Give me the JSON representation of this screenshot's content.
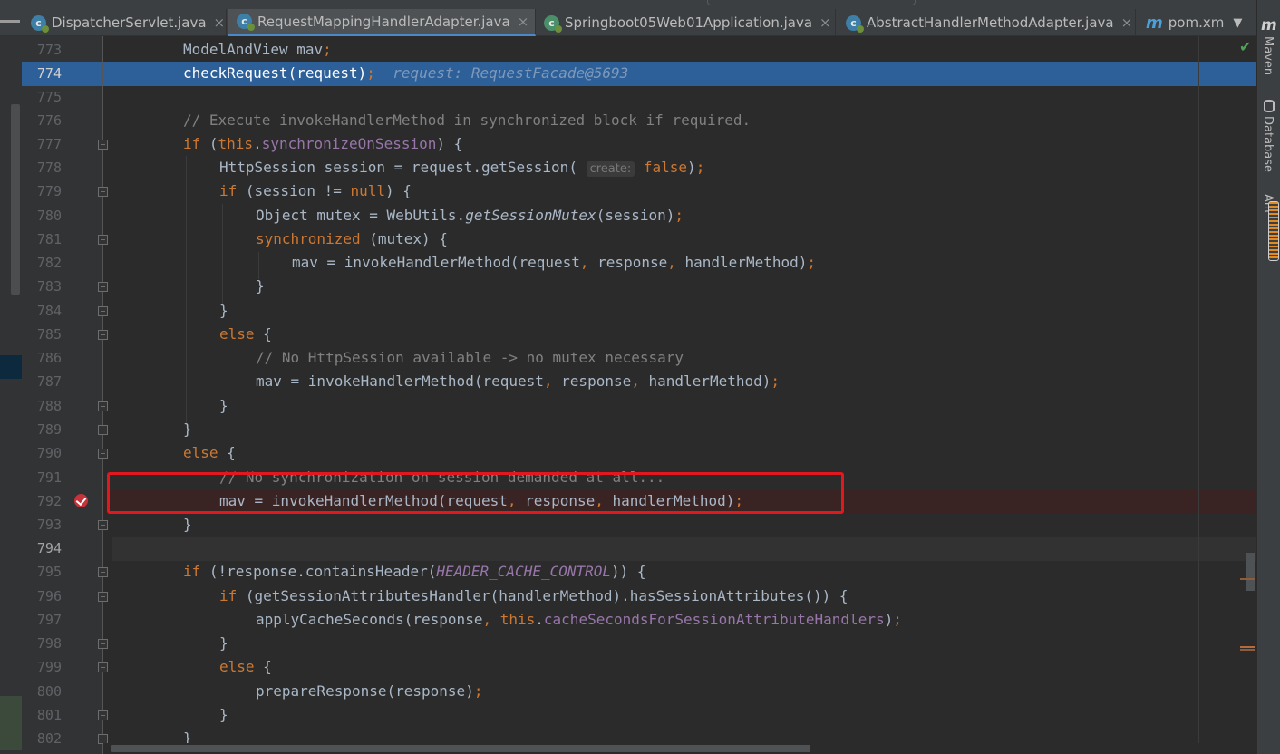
{
  "tabs": [
    {
      "label": "DispatcherServlet.java",
      "icon": "java-class-icon"
    },
    {
      "label": "RequestMappingHandlerAdapter.java",
      "icon": "java-class-icon",
      "active": true
    },
    {
      "label": "Springboot05Web01Application.java",
      "icon": "spring-boot-class-icon"
    },
    {
      "label": "AbstractHandlerMethodAdapter.java",
      "icon": "java-class-icon"
    },
    {
      "label": "pom.xm",
      "icon": "maven-icon"
    }
  ],
  "right_tool_windows": {
    "maven_icon": "m",
    "maven_label": "Maven",
    "database_label": "Database",
    "ant_label": "Ant"
  },
  "editor": {
    "current_line": "794",
    "highlighted_line": "774",
    "breakpoint_line": "792",
    "debug_value": "request: RequestFacade@5693",
    "param_hint": "create:",
    "lines": [
      {
        "n": "773",
        "t": "ModelAndView mav;"
      },
      {
        "n": "774",
        "t": "checkRequest(request);"
      },
      {
        "n": "775",
        "t": ""
      },
      {
        "n": "776",
        "t": "// Execute invokeHandlerMethod in synchronized block if required."
      },
      {
        "n": "777",
        "t": "if (this.synchronizeOnSession) {"
      },
      {
        "n": "778",
        "t": "HttpSession session = request.getSession( create: false);"
      },
      {
        "n": "779",
        "t": "if (session != null) {"
      },
      {
        "n": "780",
        "t": "Object mutex = WebUtils.getSessionMutex(session);"
      },
      {
        "n": "781",
        "t": "synchronized (mutex) {"
      },
      {
        "n": "782",
        "t": "mav = invokeHandlerMethod(request, response, handlerMethod);"
      },
      {
        "n": "783",
        "t": "}"
      },
      {
        "n": "784",
        "t": "}"
      },
      {
        "n": "785",
        "t": "else {"
      },
      {
        "n": "786",
        "t": "// No HttpSession available -> no mutex necessary"
      },
      {
        "n": "787",
        "t": "mav = invokeHandlerMethod(request, response, handlerMethod);"
      },
      {
        "n": "788",
        "t": "}"
      },
      {
        "n": "789",
        "t": "}"
      },
      {
        "n": "790",
        "t": "else {"
      },
      {
        "n": "791",
        "t": "// No synchronization on session demanded at all..."
      },
      {
        "n": "792",
        "t": "mav = invokeHandlerMethod(request, response, handlerMethod);"
      },
      {
        "n": "793",
        "t": "}"
      },
      {
        "n": "794",
        "t": ""
      },
      {
        "n": "795",
        "t": "if (!response.containsHeader(HEADER_CACHE_CONTROL)) {"
      },
      {
        "n": "796",
        "t": "if (getSessionAttributesHandler(handlerMethod).hasSessionAttributes()) {"
      },
      {
        "n": "797",
        "t": "applyCacheSeconds(response, this.cacheSecondsForSessionAttributeHandlers);"
      },
      {
        "n": "798",
        "t": "}"
      },
      {
        "n": "799",
        "t": "else {"
      },
      {
        "n": "800",
        "t": "prepareResponse(response);"
      },
      {
        "n": "801",
        "t": "}"
      },
      {
        "n": "802",
        "t": "}"
      }
    ]
  },
  "colors": {
    "keyword": "#cc7832",
    "field": "#9876aa",
    "comment": "#808080",
    "default_text": "#a9b7c6",
    "execution_line": "#2d6099",
    "breakpoint_line": "#3a2323",
    "annotation_box": "#e1191e"
  }
}
